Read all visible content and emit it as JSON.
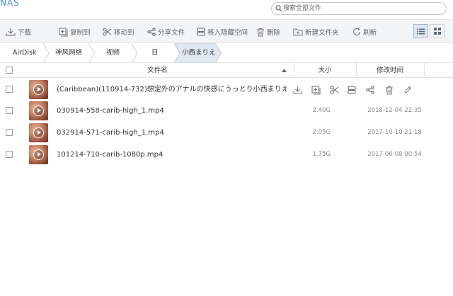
{
  "app": {
    "title": "NAS"
  },
  "search": {
    "placeholder": "搜索全部文件"
  },
  "toolbar": {
    "download": "下载",
    "copy_to": "复制到",
    "move_to": "移动到",
    "share": "分享文件",
    "move_hidden": "移入隐藏空间",
    "delete": "删除",
    "new_folder": "新建文件夹",
    "refresh": "刷新",
    "view_mode": "list"
  },
  "breadcrumb": {
    "items": [
      "AirDisk",
      "神风网络",
      "视频",
      "日",
      "小西まりえ"
    ]
  },
  "table": {
    "headers": {
      "name": "文件名",
      "size": "大小",
      "modified": "修改时间"
    },
    "sort": "name-asc",
    "rows": [
      {
        "name": "(Caribbean)(110914-732)想定外のアナルの快感にうっとり小西まりえ...",
        "size": "",
        "modified": "",
        "hover_actions": [
          "download-icon",
          "copy-icon",
          "cut-icon",
          "hide-icon",
          "share-icon",
          "trash-icon",
          "edit-icon"
        ]
      },
      {
        "name": "030914-558-carib-high_1.mp4",
        "size": "2.40G",
        "modified": "2018-12-04 22:35"
      },
      {
        "name": "032914-571-carib-high_1.mp4",
        "size": "2.05G",
        "modified": "2017-10-10 21:18"
      },
      {
        "name": "101214-710-carib-1080p.mp4",
        "size": "1.75G",
        "modified": "2017-06-08 00:54"
      }
    ]
  },
  "colors": {
    "accent": "#4a90d9",
    "toolbar_bg": "#f4f5f7",
    "crumb_active_bg": "#dfe7f1",
    "icon_gray": "#777777"
  }
}
